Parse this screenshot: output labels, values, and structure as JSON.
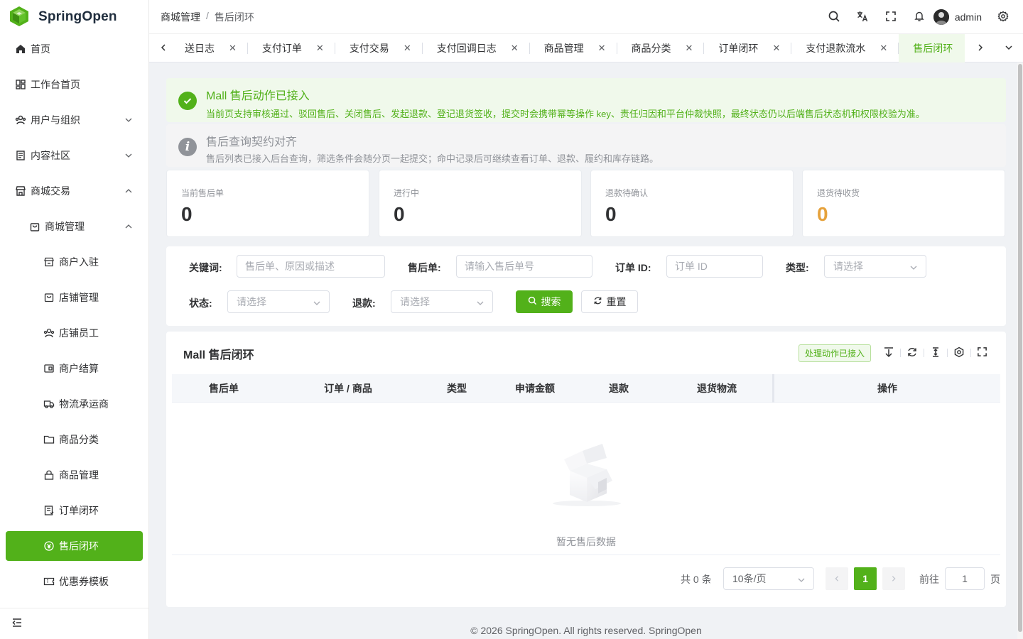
{
  "brand": {
    "name": "SpringOpen",
    "color": "#52b11a"
  },
  "sidebar": {
    "items": [
      {
        "label": "首页",
        "icon": "home-icon"
      },
      {
        "label": "工作台首页",
        "icon": "dashboard-icon"
      },
      {
        "label": "用户与组织",
        "icon": "users-icon",
        "expanded": false
      },
      {
        "label": "内容社区",
        "icon": "document-icon",
        "expanded": false
      },
      {
        "label": "商城交易",
        "icon": "store-icon",
        "expanded": true
      },
      {
        "label": "商城管理",
        "icon": "bag-icon",
        "expanded": true
      },
      {
        "label": "商户入驻",
        "icon": "shop-icon"
      },
      {
        "label": "店铺管理",
        "icon": "box-icon"
      },
      {
        "label": "店铺员工",
        "icon": "staff-icon"
      },
      {
        "label": "商户结算",
        "icon": "wallet-icon"
      },
      {
        "label": "物流承运商",
        "icon": "truck-icon"
      },
      {
        "label": "商品分类",
        "icon": "folder-icon"
      },
      {
        "label": "商品管理",
        "icon": "lock-bag-icon"
      },
      {
        "label": "订单闭环",
        "icon": "order-icon"
      },
      {
        "label": "售后闭环",
        "icon": "aftersale-icon",
        "active": true
      },
      {
        "label": "优惠券模板",
        "icon": "coupon-icon"
      }
    ]
  },
  "header": {
    "breadcrumb": [
      "商城管理",
      "售后闭环"
    ],
    "username": "admin"
  },
  "tabs": [
    {
      "label": "送日志"
    },
    {
      "label": "支付订单"
    },
    {
      "label": "支付交易"
    },
    {
      "label": "支付回调日志"
    },
    {
      "label": "商品管理"
    },
    {
      "label": "商品分类"
    },
    {
      "label": "订单闭环"
    },
    {
      "label": "支付退款流水"
    },
    {
      "label": "售后闭环",
      "active": true
    }
  ],
  "alerts": {
    "success": {
      "title": "Mall 售后动作已接入",
      "desc": "当前页支持审核通过、驳回售后、关闭售后、发起退款、登记退货签收，提交时会携带幂等操作 key、责任归因和平台仲裁快照，最终状态仍以后端售后状态机和权限校验为准。"
    },
    "info": {
      "title": "售后查询契约对齐",
      "desc": "售后列表已接入后台查询，筛选条件会随分页一起提交；命中记录后可继续查看订单、退款、履约和库存链路。"
    }
  },
  "stats": [
    {
      "label": "当前售后单",
      "value": "0"
    },
    {
      "label": "进行中",
      "value": "0"
    },
    {
      "label": "退款待确认",
      "value": "0"
    },
    {
      "label": "退货待收货",
      "value": "0",
      "color": "#e6a23c"
    }
  ],
  "filters": {
    "keyword_label": "关键词:",
    "keyword_placeholder": "售后单、原因或描述",
    "aftersale_label": "售后单:",
    "aftersale_placeholder": "请输入售后单号",
    "order_label": "订单 ID:",
    "order_placeholder": "订单 ID",
    "type_label": "类型:",
    "type_placeholder": "请选择",
    "status_label": "状态:",
    "status_placeholder": "请选择",
    "refund_label": "退款:",
    "refund_placeholder": "请选择",
    "search_label": "搜索",
    "reset_label": "重置"
  },
  "table": {
    "title": "Mall 售后闭环",
    "tag": "处理动作已接入",
    "columns": [
      "售后单",
      "订单 / 商品",
      "类型",
      "申请金额",
      "退款",
      "退货物流",
      "操作"
    ],
    "empty_text": "暂无售后数据"
  },
  "pagination": {
    "total": "共 0 条",
    "page_size": "10条/页",
    "current": "1",
    "goto_label": "前往",
    "goto_value": "1",
    "page_suffix": "页"
  },
  "footer": "© 2026 SpringOpen. All rights reserved. SpringOpen"
}
